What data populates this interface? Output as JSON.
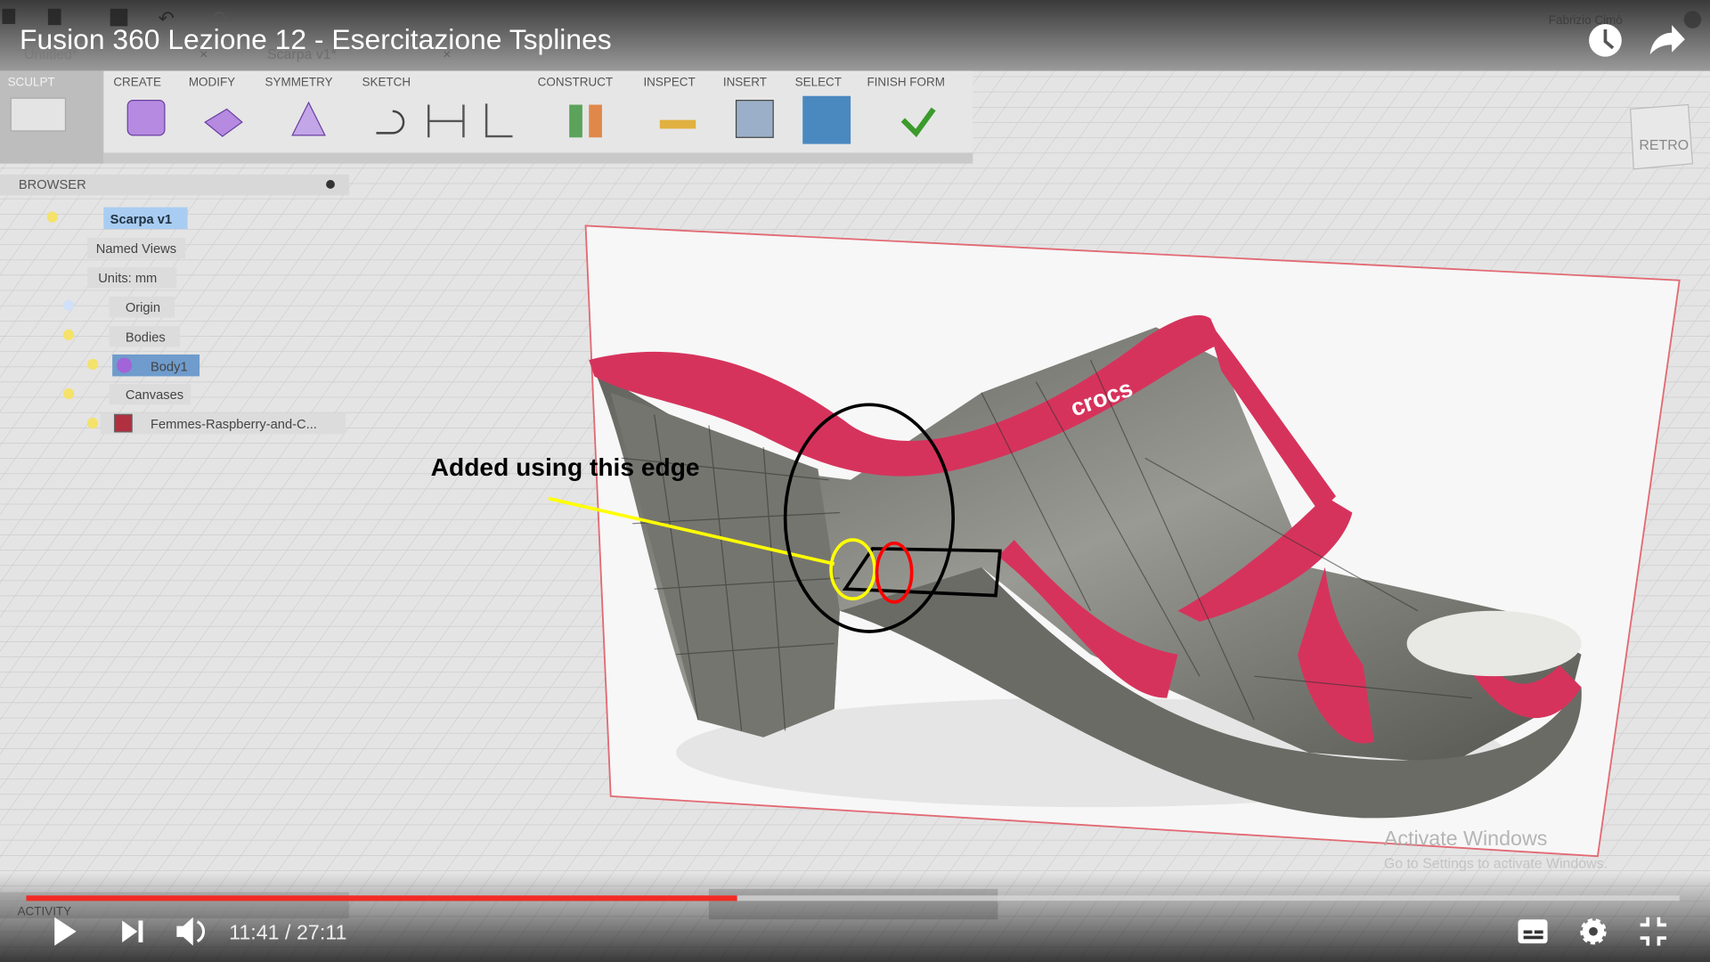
{
  "video": {
    "title": "Fusion 360 Lezione 12 - Esercitazione Tsplines",
    "current_time": "11:41",
    "duration": "27:11",
    "time_display": "11:41 / 27:11",
    "progress_fraction": 0.43,
    "progress_color": "#f12b24",
    "icons": [
      "watch-later-icon",
      "share-icon",
      "play-icon",
      "next-icon",
      "volume-icon",
      "subtitles-icon",
      "settings-icon",
      "exit-fullscreen-icon"
    ]
  },
  "app": {
    "user": "Fabrizio Cimò",
    "tabs": [
      "Untitled*",
      "Scarpa v1*"
    ],
    "toolbar": {
      "workspace": "SCULPT",
      "groups": [
        "CREATE",
        "MODIFY",
        "SYMMETRY",
        "SKETCH",
        "CONSTRUCT",
        "INSPECT",
        "INSERT",
        "SELECT",
        "FINISH FORM"
      ]
    },
    "browser": {
      "title": "BROWSER",
      "items": [
        {
          "label": "Scarpa v1"
        },
        {
          "label": "Named Views"
        },
        {
          "label": "Units: mm"
        },
        {
          "label": "Origin"
        },
        {
          "label": "Bodies"
        },
        {
          "label": "Body1"
        },
        {
          "label": "Canvases"
        },
        {
          "label": "Femmes-Raspberry-and-C..."
        }
      ]
    },
    "viewcube_label": "RETRO",
    "activity_label": "ACTIVITY"
  },
  "annotation": {
    "text": "Added using this edge",
    "colors": {
      "pointer": "#ffff00",
      "highlight": "#ff0000",
      "outline": "#000000"
    }
  },
  "shoe_logo": "crocs",
  "watermark": {
    "line1": "Activate Windows",
    "line2": "Go to Settings to activate Windows."
  }
}
